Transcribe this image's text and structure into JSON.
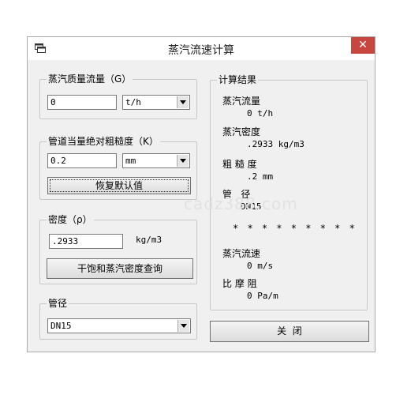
{
  "window": {
    "title": "蒸汽流速计算",
    "close_glyph": "✕"
  },
  "mass_flow": {
    "legend": "蒸汽质量流量（G）",
    "value": "0",
    "unit": "t/h"
  },
  "roughness": {
    "legend": "管道当量绝对粗糙度（K）",
    "value": "0.2",
    "unit": "mm",
    "reset_button": "恢复默认值"
  },
  "density": {
    "legend": "密度（ρ）",
    "value": ".2933",
    "unit": "kg/m3",
    "lookup_button": "干饱和蒸汽密度查询"
  },
  "pipe": {
    "legend": "管径",
    "value": "DN15"
  },
  "results": {
    "legend": "计算结果",
    "flow_label": "蒸汽流量",
    "flow_value": "0 t/h",
    "density_label": "蒸汽密度",
    "density_value": ".2933 kg/m3",
    "roughness_label": "粗 糙 度",
    "roughness_value": ".2 mm",
    "diameter_label": "管   径",
    "diameter_value": "DN15",
    "separator": "* * * * * * * * *",
    "velocity_label": "蒸汽流速",
    "velocity_value": "0 m/s",
    "friction_label": "比 摩 阻",
    "friction_value": "0 Pa/m"
  },
  "close_button": "关  闭",
  "watermark": "cadz388.com"
}
